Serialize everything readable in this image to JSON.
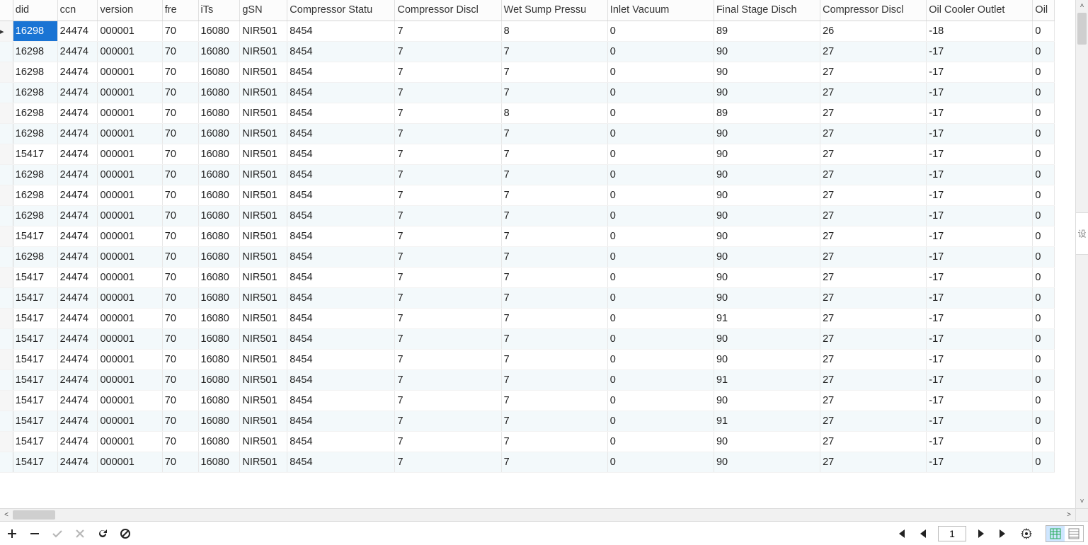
{
  "columns": [
    {
      "key": "did",
      "label": "did",
      "w": 62
    },
    {
      "key": "ccn",
      "label": "ccn",
      "w": 56
    },
    {
      "key": "version",
      "label": "version",
      "w": 90
    },
    {
      "key": "fre",
      "label": "fre",
      "w": 50
    },
    {
      "key": "its",
      "label": "iTs",
      "w": 58
    },
    {
      "key": "gsn",
      "label": "gSN",
      "w": 66
    },
    {
      "key": "cstat",
      "label": "Compressor Statu",
      "w": 150
    },
    {
      "key": "cdisc1",
      "label": "Compressor Discl",
      "w": 148
    },
    {
      "key": "wsump",
      "label": "Wet Sump Pressu",
      "w": 148
    },
    {
      "key": "inlet",
      "label": "Inlet Vacuum",
      "w": 148
    },
    {
      "key": "fstage",
      "label": "Final Stage Disch",
      "w": 148
    },
    {
      "key": "cdisc2",
      "label": "Compressor Discl",
      "w": 148
    },
    {
      "key": "oilout",
      "label": "Oil Cooler Outlet",
      "w": 148
    },
    {
      "key": "oil",
      "label": "Oil",
      "w": 30
    }
  ],
  "header_sort_label": "^",
  "rows": [
    {
      "did": "16298",
      "ccn": "24474",
      "version": "000001",
      "fre": "70",
      "its": "16080",
      "gsn": "NIR501",
      "cstat": "8454",
      "cdisc1": "7",
      "wsump": "8",
      "inlet": "0",
      "fstage": "89",
      "cdisc2": "26",
      "oilout": "-18",
      "oil": "0"
    },
    {
      "did": "16298",
      "ccn": "24474",
      "version": "000001",
      "fre": "70",
      "its": "16080",
      "gsn": "NIR501",
      "cstat": "8454",
      "cdisc1": "7",
      "wsump": "7",
      "inlet": "0",
      "fstage": "90",
      "cdisc2": "27",
      "oilout": "-17",
      "oil": "0"
    },
    {
      "did": "16298",
      "ccn": "24474",
      "version": "000001",
      "fre": "70",
      "its": "16080",
      "gsn": "NIR501",
      "cstat": "8454",
      "cdisc1": "7",
      "wsump": "7",
      "inlet": "0",
      "fstage": "90",
      "cdisc2": "27",
      "oilout": "-17",
      "oil": "0"
    },
    {
      "did": "16298",
      "ccn": "24474",
      "version": "000001",
      "fre": "70",
      "its": "16080",
      "gsn": "NIR501",
      "cstat": "8454",
      "cdisc1": "7",
      "wsump": "7",
      "inlet": "0",
      "fstage": "90",
      "cdisc2": "27",
      "oilout": "-17",
      "oil": "0"
    },
    {
      "did": "16298",
      "ccn": "24474",
      "version": "000001",
      "fre": "70",
      "its": "16080",
      "gsn": "NIR501",
      "cstat": "8454",
      "cdisc1": "7",
      "wsump": "8",
      "inlet": "0",
      "fstage": "89",
      "cdisc2": "27",
      "oilout": "-17",
      "oil": "0"
    },
    {
      "did": "16298",
      "ccn": "24474",
      "version": "000001",
      "fre": "70",
      "its": "16080",
      "gsn": "NIR501",
      "cstat": "8454",
      "cdisc1": "7",
      "wsump": "7",
      "inlet": "0",
      "fstage": "90",
      "cdisc2": "27",
      "oilout": "-17",
      "oil": "0"
    },
    {
      "did": "15417",
      "ccn": "24474",
      "version": "000001",
      "fre": "70",
      "its": "16080",
      "gsn": "NIR501",
      "cstat": "8454",
      "cdisc1": "7",
      "wsump": "7",
      "inlet": "0",
      "fstage": "90",
      "cdisc2": "27",
      "oilout": "-17",
      "oil": "0"
    },
    {
      "did": "16298",
      "ccn": "24474",
      "version": "000001",
      "fre": "70",
      "its": "16080",
      "gsn": "NIR501",
      "cstat": "8454",
      "cdisc1": "7",
      "wsump": "7",
      "inlet": "0",
      "fstage": "90",
      "cdisc2": "27",
      "oilout": "-17",
      "oil": "0"
    },
    {
      "did": "16298",
      "ccn": "24474",
      "version": "000001",
      "fre": "70",
      "its": "16080",
      "gsn": "NIR501",
      "cstat": "8454",
      "cdisc1": "7",
      "wsump": "7",
      "inlet": "0",
      "fstage": "90",
      "cdisc2": "27",
      "oilout": "-17",
      "oil": "0"
    },
    {
      "did": "16298",
      "ccn": "24474",
      "version": "000001",
      "fre": "70",
      "its": "16080",
      "gsn": "NIR501",
      "cstat": "8454",
      "cdisc1": "7",
      "wsump": "7",
      "inlet": "0",
      "fstage": "90",
      "cdisc2": "27",
      "oilout": "-17",
      "oil": "0"
    },
    {
      "did": "15417",
      "ccn": "24474",
      "version": "000001",
      "fre": "70",
      "its": "16080",
      "gsn": "NIR501",
      "cstat": "8454",
      "cdisc1": "7",
      "wsump": "7",
      "inlet": "0",
      "fstage": "90",
      "cdisc2": "27",
      "oilout": "-17",
      "oil": "0"
    },
    {
      "did": "16298",
      "ccn": "24474",
      "version": "000001",
      "fre": "70",
      "its": "16080",
      "gsn": "NIR501",
      "cstat": "8454",
      "cdisc1": "7",
      "wsump": "7",
      "inlet": "0",
      "fstage": "90",
      "cdisc2": "27",
      "oilout": "-17",
      "oil": "0"
    },
    {
      "did": "15417",
      "ccn": "24474",
      "version": "000001",
      "fre": "70",
      "its": "16080",
      "gsn": "NIR501",
      "cstat": "8454",
      "cdisc1": "7",
      "wsump": "7",
      "inlet": "0",
      "fstage": "90",
      "cdisc2": "27",
      "oilout": "-17",
      "oil": "0"
    },
    {
      "did": "15417",
      "ccn": "24474",
      "version": "000001",
      "fre": "70",
      "its": "16080",
      "gsn": "NIR501",
      "cstat": "8454",
      "cdisc1": "7",
      "wsump": "7",
      "inlet": "0",
      "fstage": "90",
      "cdisc2": "27",
      "oilout": "-17",
      "oil": "0"
    },
    {
      "did": "15417",
      "ccn": "24474",
      "version": "000001",
      "fre": "70",
      "its": "16080",
      "gsn": "NIR501",
      "cstat": "8454",
      "cdisc1": "7",
      "wsump": "7",
      "inlet": "0",
      "fstage": "91",
      "cdisc2": "27",
      "oilout": "-17",
      "oil": "0"
    },
    {
      "did": "15417",
      "ccn": "24474",
      "version": "000001",
      "fre": "70",
      "its": "16080",
      "gsn": "NIR501",
      "cstat": "8454",
      "cdisc1": "7",
      "wsump": "7",
      "inlet": "0",
      "fstage": "90",
      "cdisc2": "27",
      "oilout": "-17",
      "oil": "0"
    },
    {
      "did": "15417",
      "ccn": "24474",
      "version": "000001",
      "fre": "70",
      "its": "16080",
      "gsn": "NIR501",
      "cstat": "8454",
      "cdisc1": "7",
      "wsump": "7",
      "inlet": "0",
      "fstage": "90",
      "cdisc2": "27",
      "oilout": "-17",
      "oil": "0"
    },
    {
      "did": "15417",
      "ccn": "24474",
      "version": "000001",
      "fre": "70",
      "its": "16080",
      "gsn": "NIR501",
      "cstat": "8454",
      "cdisc1": "7",
      "wsump": "7",
      "inlet": "0",
      "fstage": "91",
      "cdisc2": "27",
      "oilout": "-17",
      "oil": "0"
    },
    {
      "did": "15417",
      "ccn": "24474",
      "version": "000001",
      "fre": "70",
      "its": "16080",
      "gsn": "NIR501",
      "cstat": "8454",
      "cdisc1": "7",
      "wsump": "7",
      "inlet": "0",
      "fstage": "90",
      "cdisc2": "27",
      "oilout": "-17",
      "oil": "0"
    },
    {
      "did": "15417",
      "ccn": "24474",
      "version": "000001",
      "fre": "70",
      "its": "16080",
      "gsn": "NIR501",
      "cstat": "8454",
      "cdisc1": "7",
      "wsump": "7",
      "inlet": "0",
      "fstage": "91",
      "cdisc2": "27",
      "oilout": "-17",
      "oil": "0"
    },
    {
      "did": "15417",
      "ccn": "24474",
      "version": "000001",
      "fre": "70",
      "its": "16080",
      "gsn": "NIR501",
      "cstat": "8454",
      "cdisc1": "7",
      "wsump": "7",
      "inlet": "0",
      "fstage": "90",
      "cdisc2": "27",
      "oilout": "-17",
      "oil": "0"
    },
    {
      "did": "15417",
      "ccn": "24474",
      "version": "000001",
      "fre": "70",
      "its": "16080",
      "gsn": "NIR501",
      "cstat": "8454",
      "cdisc1": "7",
      "wsump": "7",
      "inlet": "0",
      "fstage": "90",
      "cdisc2": "27",
      "oilout": "-17",
      "oil": "0"
    }
  ],
  "selected_row": 0,
  "selected_col": "did",
  "nav": {
    "page": "1"
  },
  "side_ribbon_label": "设"
}
